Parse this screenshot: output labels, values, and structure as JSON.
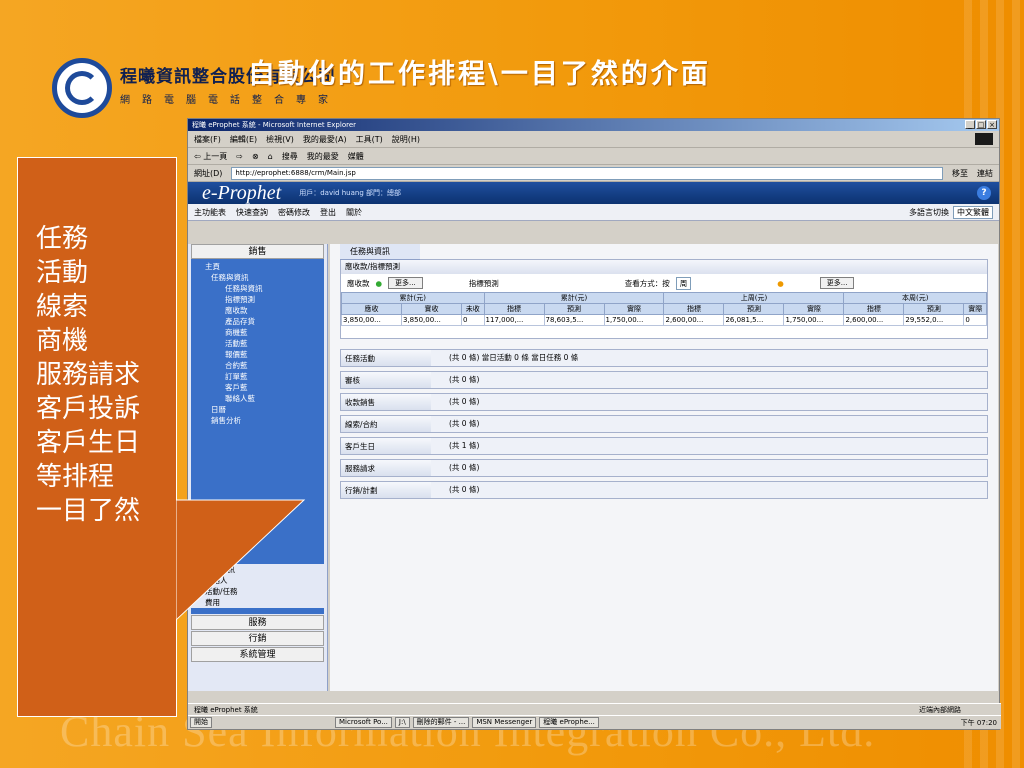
{
  "slide": {
    "company_name": "程曦資訊整合股份有限公司",
    "company_sub": "網路電腦電話整合專家",
    "title": "自動化的工作排程\\一目了然的介面",
    "watermark": "Chain Sea Information Integration Co., Ltd."
  },
  "callout": {
    "lines": [
      "任務",
      "活動",
      "線索",
      "商機",
      "服務請求",
      "客戶投訴",
      "客戶生日",
      "等排程",
      "一目了然"
    ]
  },
  "ie": {
    "title": "程曦 eProphet 系統 - Microsoft Internet Explorer",
    "menu": [
      "檔案(F)",
      "編輯(E)",
      "檢視(V)",
      "我的最愛(A)",
      "工具(T)",
      "說明(H)"
    ],
    "toolbar": [
      "上一頁",
      "搜尋",
      "我的最愛",
      "媒體"
    ],
    "address_label": "網址(D)",
    "address": "http://eprophet:6888/crm/Main.jsp",
    "go": "移至",
    "links": "連結"
  },
  "app": {
    "logo": "e-Prophet",
    "user": "用戶：david huang  部門：總部",
    "tools": [
      "主功能表",
      "快速查詢",
      "密碼修改",
      "登出",
      "關於"
    ],
    "lang_label": "多語言切換",
    "lang": "中文繁體"
  },
  "sidebar": {
    "header": "銷售",
    "tree": [
      {
        "t": "主頁",
        "c": "l0"
      },
      {
        "t": "任務與資訊",
        "c": "l1"
      },
      {
        "t": "任務與資訊",
        "c": "l2"
      },
      {
        "t": "指標預測",
        "c": "l2"
      },
      {
        "t": "應收款",
        "c": "l2"
      },
      {
        "t": "產品存貨",
        "c": "l2"
      },
      {
        "t": "商機藍",
        "c": "l2"
      },
      {
        "t": "活動藍",
        "c": "l2"
      },
      {
        "t": "報價藍",
        "c": "l2"
      },
      {
        "t": "合約藍",
        "c": "l2"
      },
      {
        "t": "訂單藍",
        "c": "l2"
      },
      {
        "t": "客戶藍",
        "c": "l2"
      },
      {
        "t": "聯絡人藍",
        "c": "l2"
      },
      {
        "t": "日曆",
        "c": "l1"
      },
      {
        "t": "銷售分析",
        "c": "l1"
      }
    ],
    "tree_tail": [
      "相關資訊",
      "聯絡人",
      "活動/任務",
      "費用"
    ],
    "buttons": [
      "服務",
      "行銷",
      "系統管理"
    ]
  },
  "content": {
    "tab": "任務與資訊",
    "panel_title": "應收款/指標預測",
    "receivable": "應收款",
    "forecast": "指標預測",
    "more": "更多...",
    "view_mode": "查看方式：按",
    "view_value": "周",
    "groups": [
      "累計(元)",
      "累計(元)",
      "上周(元)",
      "本周(元)"
    ],
    "cols": [
      "應收",
      "實收",
      "未收",
      "指標",
      "預測",
      "實際",
      "指標",
      "預測",
      "實際",
      "指標",
      "預測",
      "實際"
    ],
    "row": [
      "3,850,00...",
      "3,850,00...",
      "0",
      "117,000,...",
      "78,603,5...",
      "1,750,00...",
      "2,600,00...",
      "26,081,5...",
      "1,750,00...",
      "2,600,00...",
      "29,552,0...",
      "0"
    ],
    "sections": [
      {
        "name": "任務活動",
        "count": "(共 0 條) 當日活動 0 條 當日任務 0 條"
      },
      {
        "name": "審核",
        "count": "(共 0 條)"
      },
      {
        "name": "收款銷售",
        "count": "(共 0 條)"
      },
      {
        "name": "線索/合約",
        "count": "(共 0 條)"
      },
      {
        "name": "客戶生日",
        "count": "(共 1 條)"
      },
      {
        "name": "服務請求",
        "count": "(共 0 條)"
      },
      {
        "name": "行銷/計劃",
        "count": "(共 0 條)"
      }
    ]
  },
  "status": {
    "left": "程曦 eProphet 系統",
    "zone": "近端內部網路"
  },
  "taskbar": {
    "start": "開始",
    "items": [
      "Microsoft Po...",
      "J:\\",
      "刪除的郵件 - ...",
      "MSN Messenger",
      "程曦 eProphe..."
    ],
    "clock": "下午 07:20"
  }
}
